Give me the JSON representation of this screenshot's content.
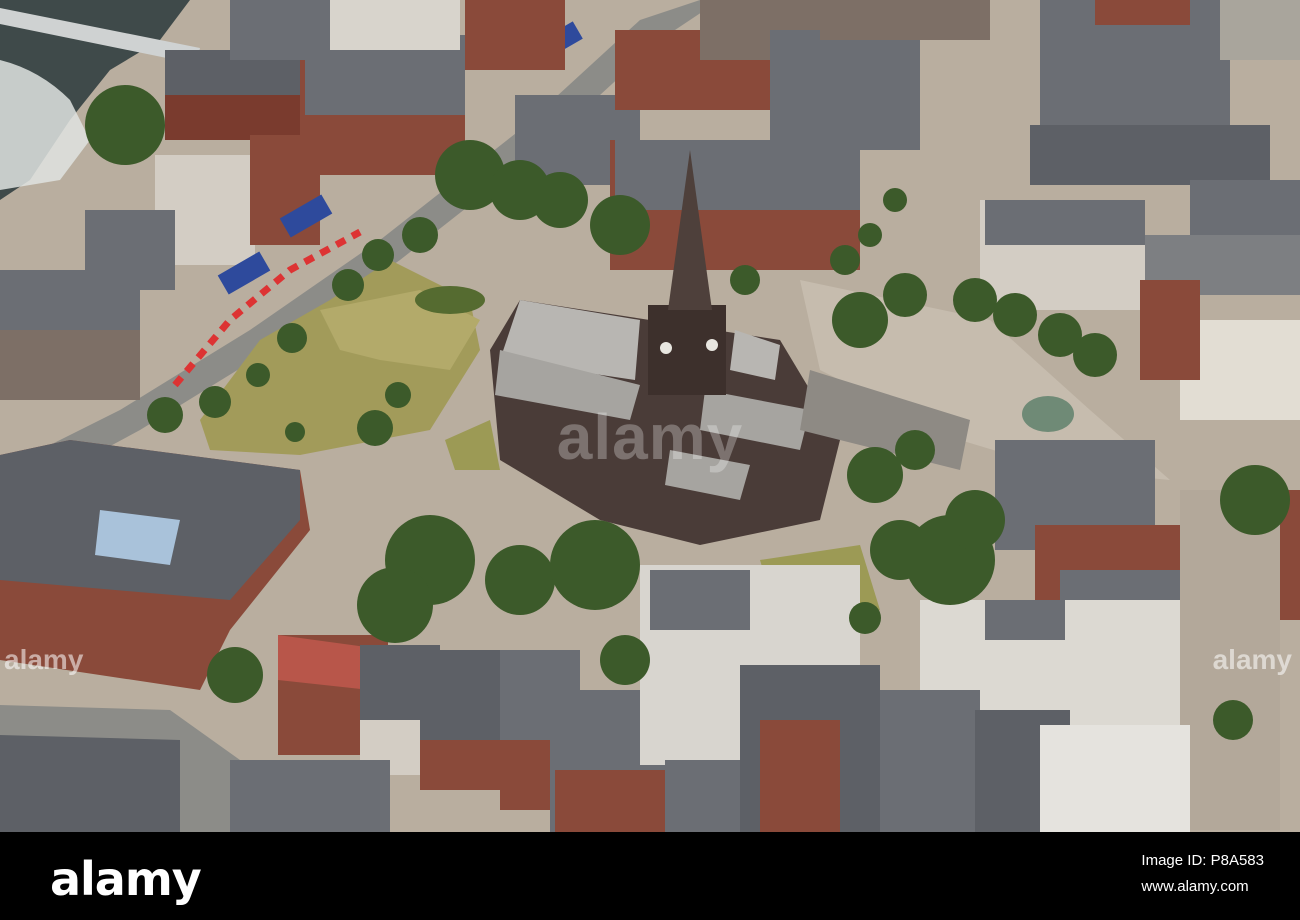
{
  "watermark": {
    "center": "alamy",
    "side_left": "alamy",
    "side_right": "alamy"
  },
  "footer": {
    "brand": "alamy",
    "image_id_line": "Image ID: P8A583",
    "site_line": "www.alamy.com"
  },
  "colors": {
    "roof_slate": "#5d6066",
    "brick": "#7a3b2e",
    "stone_dark": "#4a3c38",
    "grass": "#9c9a55",
    "paving": "#bfb4a5",
    "tree": "#3c5a2a",
    "river": "#3f4a4a",
    "footer_bg": "#000000"
  }
}
